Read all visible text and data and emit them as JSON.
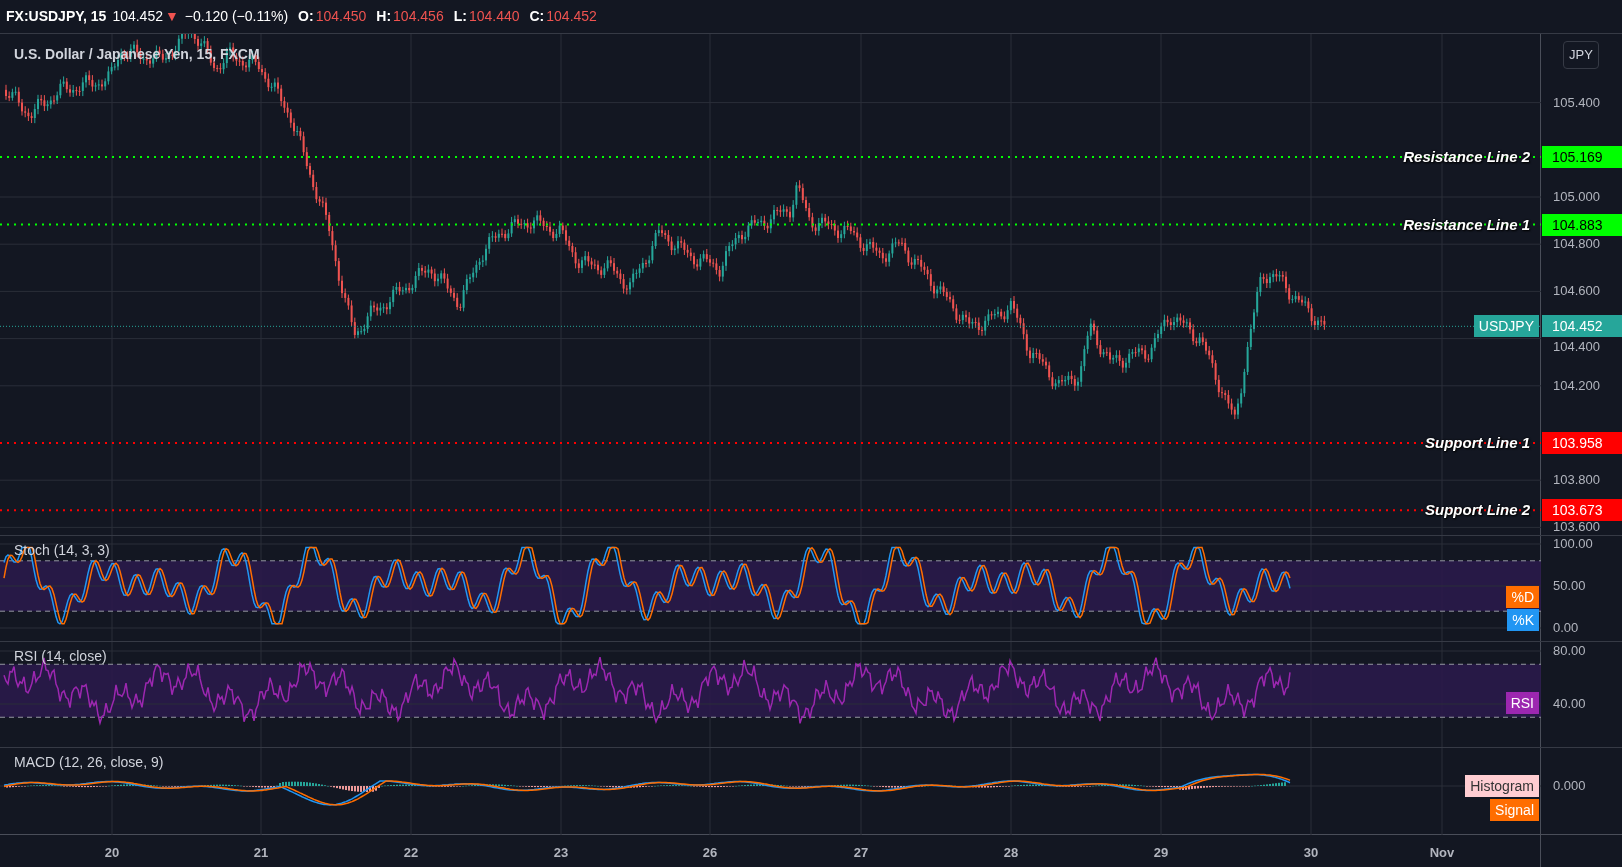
{
  "header": {
    "symbol": "FX:USDJPY, 15",
    "last": "104.452",
    "arrow": "▼",
    "change": "−0.120 (−0.11%)",
    "ohlc": [
      {
        "label": "O:",
        "value": "104.450"
      },
      {
        "label": "H:",
        "value": "104.456"
      },
      {
        "label": "L:",
        "value": "104.440"
      },
      {
        "label": "C:",
        "value": "104.452"
      }
    ]
  },
  "main_pane": {
    "title": "U.S. Dollar / Japanese Yen, 15, FXCM",
    "currency_button": "JPY",
    "price_axis": [
      "105.400",
      "105.000",
      "104.800",
      "104.600",
      "104.400",
      "104.200",
      "103.800",
      "103.600"
    ],
    "lines": [
      {
        "label": "Resistance Line 2",
        "price": "105.169",
        "color": "#00ff00"
      },
      {
        "label": "Resistance Line 1",
        "price": "104.883",
        "color": "#00ff00"
      },
      {
        "label": "Support Line 1",
        "price": "103.958",
        "color": "#ff0000"
      },
      {
        "label": "Support Line 2",
        "price": "103.673",
        "color": "#ff0000"
      }
    ],
    "last_price": {
      "label": "USDJPY",
      "price": "104.452"
    }
  },
  "stoch_pane": {
    "title": "Stoch (14, 3, 3)",
    "axis": [
      "100.00",
      "50.00",
      "0.00"
    ],
    "legend": [
      {
        "label": "%D",
        "color": "#ff6d00"
      },
      {
        "label": "%K",
        "color": "#2196f3"
      }
    ]
  },
  "rsi_pane": {
    "title": "RSI (14, close)",
    "axis": [
      "80.00",
      "40.00"
    ],
    "legend": [
      {
        "label": "RSI",
        "color": "#9c27b0"
      }
    ]
  },
  "macd_pane": {
    "title": "MACD (12, 26, close, 9)",
    "axis": [
      "0.000"
    ],
    "legend": [
      {
        "label": "Histogram",
        "color": "#ffcdd2"
      },
      {
        "label": "Signal",
        "color": "#ff6d00"
      }
    ]
  },
  "time_axis": [
    "20",
    "21",
    "22",
    "23",
    "26",
    "27",
    "28",
    "29",
    "30",
    "Nov"
  ]
}
